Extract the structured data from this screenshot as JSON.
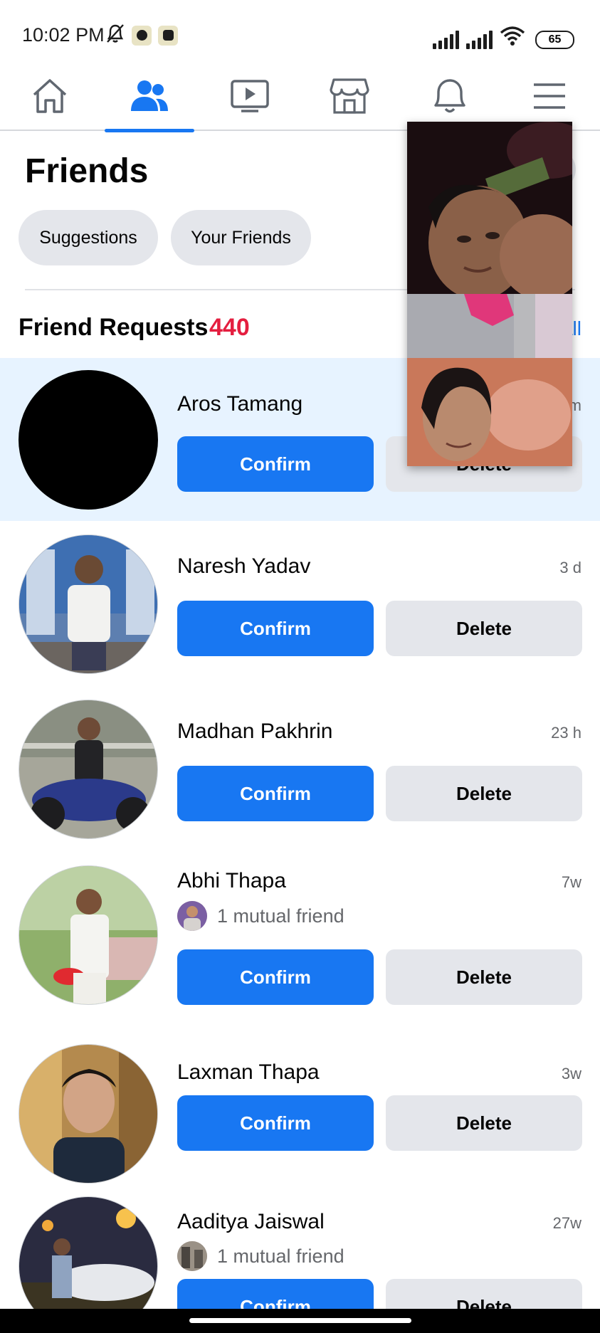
{
  "status_bar": {
    "time": "10:02 PM",
    "battery": "65",
    "icons": [
      "muted-bell-icon",
      "facebook-notification-icon",
      "instagram-notification-icon",
      "signal-icon",
      "signal-icon",
      "wifi-icon",
      "battery-icon"
    ]
  },
  "nav": {
    "items": [
      {
        "name": "home",
        "icon": "home-icon"
      },
      {
        "name": "friends",
        "icon": "friends-icon",
        "active": true
      },
      {
        "name": "watch",
        "icon": "video-icon"
      },
      {
        "name": "marketplace",
        "icon": "marketplace-icon"
      },
      {
        "name": "notifications",
        "icon": "bell-icon"
      },
      {
        "name": "menu",
        "icon": "hamburger-menu-icon"
      }
    ],
    "accent": "#1877f2"
  },
  "page": {
    "title": "Friends",
    "chips": [
      "Suggestions",
      "Your Friends"
    ]
  },
  "requests": {
    "title": "Friend Requests",
    "count": "440",
    "see_all": "See all",
    "count_color": "#e41e3f",
    "items": [
      {
        "name": "Aros Tamang",
        "time": "m",
        "mutual": "",
        "confirm": "Confirm",
        "delete": "Delete"
      },
      {
        "name": "Naresh Yadav",
        "time": "3 d",
        "mutual": "",
        "confirm": "Confirm",
        "delete": "Delete"
      },
      {
        "name": "Madhan Pakhrin",
        "time": "23 h",
        "mutual": "",
        "confirm": "Confirm",
        "delete": "Delete"
      },
      {
        "name": "Abhi Thapa",
        "time": "7w",
        "mutual": "1 mutual friend",
        "confirm": "Confirm",
        "delete": "Delete"
      },
      {
        "name": "Laxman Thapa",
        "time": "3w",
        "mutual": "",
        "confirm": "Confirm",
        "delete": "Delete"
      },
      {
        "name": "Aaditya Jaiswal",
        "time": "27w",
        "mutual": "1 mutual friend",
        "confirm": "Confirm",
        "delete": "Delete"
      }
    ]
  }
}
